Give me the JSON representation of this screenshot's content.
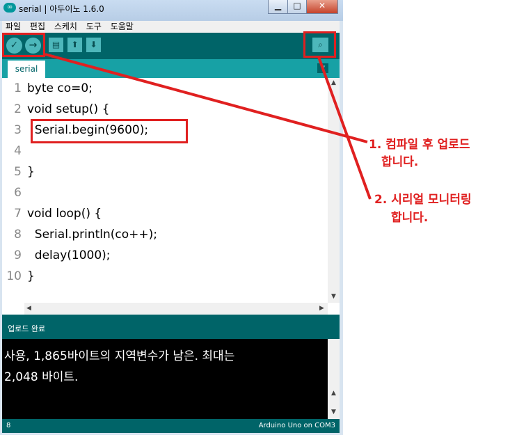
{
  "window": {
    "title": "serial | 아두이노 1.6.0",
    "minimize": "▁",
    "maximize": "□",
    "close": "✕"
  },
  "menu": {
    "items": [
      "파일",
      "편집",
      "스케치",
      "도구",
      "도움말"
    ]
  },
  "toolbar": {
    "verify_icon": "✓",
    "upload_icon": "→",
    "new_icon": "▤",
    "open_icon": "⬆",
    "save_icon": "⬇",
    "serial_monitor_icon": "⌕"
  },
  "tab": {
    "label": "serial",
    "menu_icon": "▼"
  },
  "editor": {
    "line_numbers": [
      "1",
      "2",
      "3",
      "4",
      "5",
      "6",
      "7",
      "8",
      "9",
      "10"
    ],
    "lines": [
      "byte co=0;",
      "void setup() {",
      "  Serial.begin(9600);",
      "",
      "}",
      "",
      "void loop() {",
      "  Serial.println(co++);",
      "  delay(1000);",
      "}"
    ]
  },
  "status": {
    "text": "업로드 완료"
  },
  "console": {
    "lines": [
      "사용, 1,865바이트의 지역변수가 남은. 최대는",
      "2,048 바이트."
    ]
  },
  "footer": {
    "line": "8",
    "board": "Arduino Uno on COM3"
  },
  "annotations": {
    "step1_line1": "1. 컴파일 후 업로드",
    "step1_line2": "합니다.",
    "step2_line1": "2. 시리얼 모니터링",
    "step2_line2": "합니다."
  },
  "colors": {
    "teal_dark": "#006468",
    "teal_light": "#17a1a5",
    "annotation_red": "#e02020"
  }
}
